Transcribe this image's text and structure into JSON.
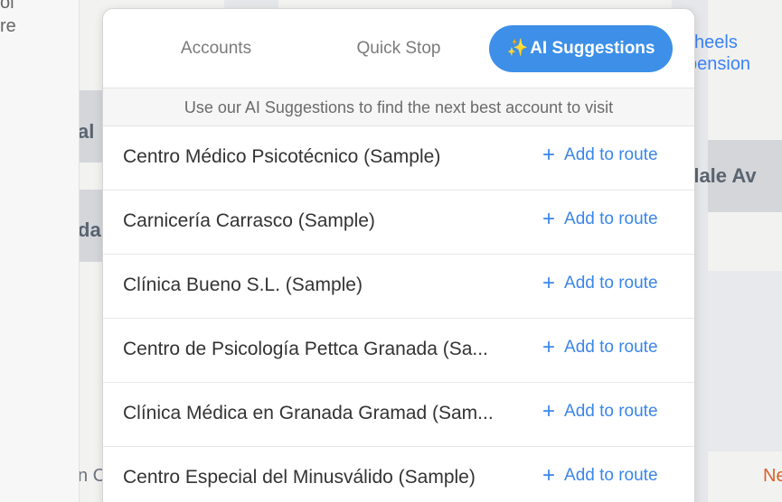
{
  "side_panel": {
    "fragment_1": "ol",
    "fragment_2": "re"
  },
  "map": {
    "label_left_1": "al",
    "label_left_2": "da",
    "label_avenue": "dale Av",
    "wheels_line1": "heels",
    "wheels_line2": "pension",
    "bottom_left_fragment": "n C",
    "bottom_right_fragment": "Ne"
  },
  "tabs": {
    "accounts": "Accounts",
    "quick_stop": "Quick Stop",
    "ai_sparkle": "✨",
    "ai_suggestions": "AI Suggestions"
  },
  "subheader": "Use our AI Suggestions to find the next best account to visit",
  "add_label": "Add to route",
  "add_icon": "+",
  "accounts": [
    {
      "name": "Centro Médico Psicotécnico (Sample)"
    },
    {
      "name": "Carnicería Carrasco (Sample)"
    },
    {
      "name": "Clínica Bueno S.L. (Sample)"
    },
    {
      "name": "Centro de Psicología Pettca Granada (Sa..."
    },
    {
      "name": "Clínica Médica en Granada Gramad (Sam..."
    },
    {
      "name": "Centro Especial del Minusválido (Sample)"
    }
  ]
}
